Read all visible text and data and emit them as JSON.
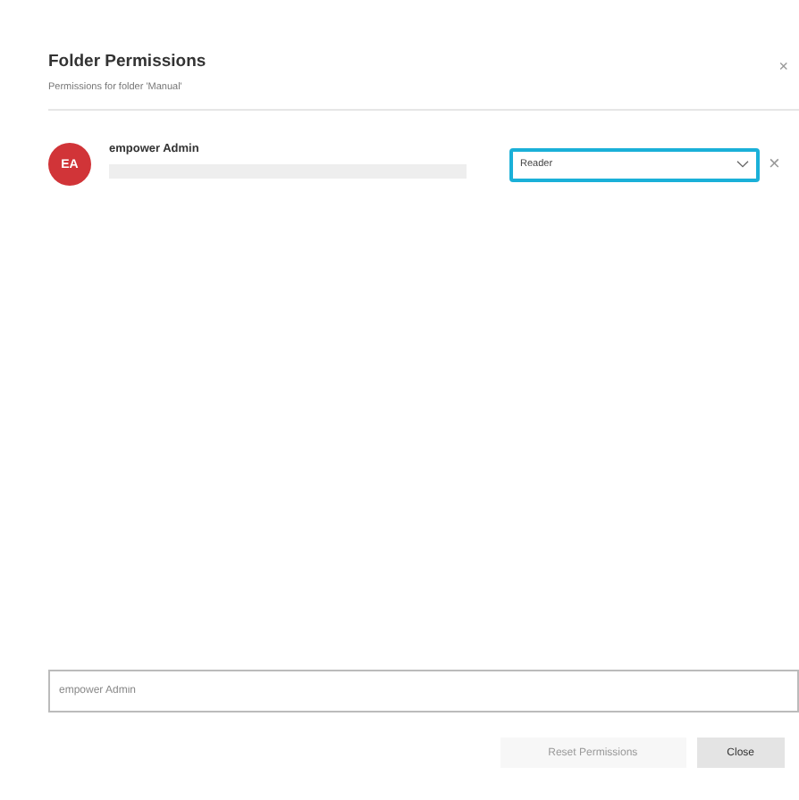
{
  "dialog": {
    "title": "Folder Permissions",
    "subtitle": "Permissions for folder 'Manual'",
    "close": "×"
  },
  "entries": [
    {
      "initials": "EA",
      "name": "empower Admin",
      "color": "#d13438",
      "role": "Reader",
      "focused": true,
      "remove": "×"
    }
  ],
  "add_field": {
    "placeholder": "empower Admin"
  },
  "buttons": [
    {
      "label": "Reset Permissions",
      "disabled": true
    },
    {
      "label": "Close",
      "disabled": false
    }
  ]
}
